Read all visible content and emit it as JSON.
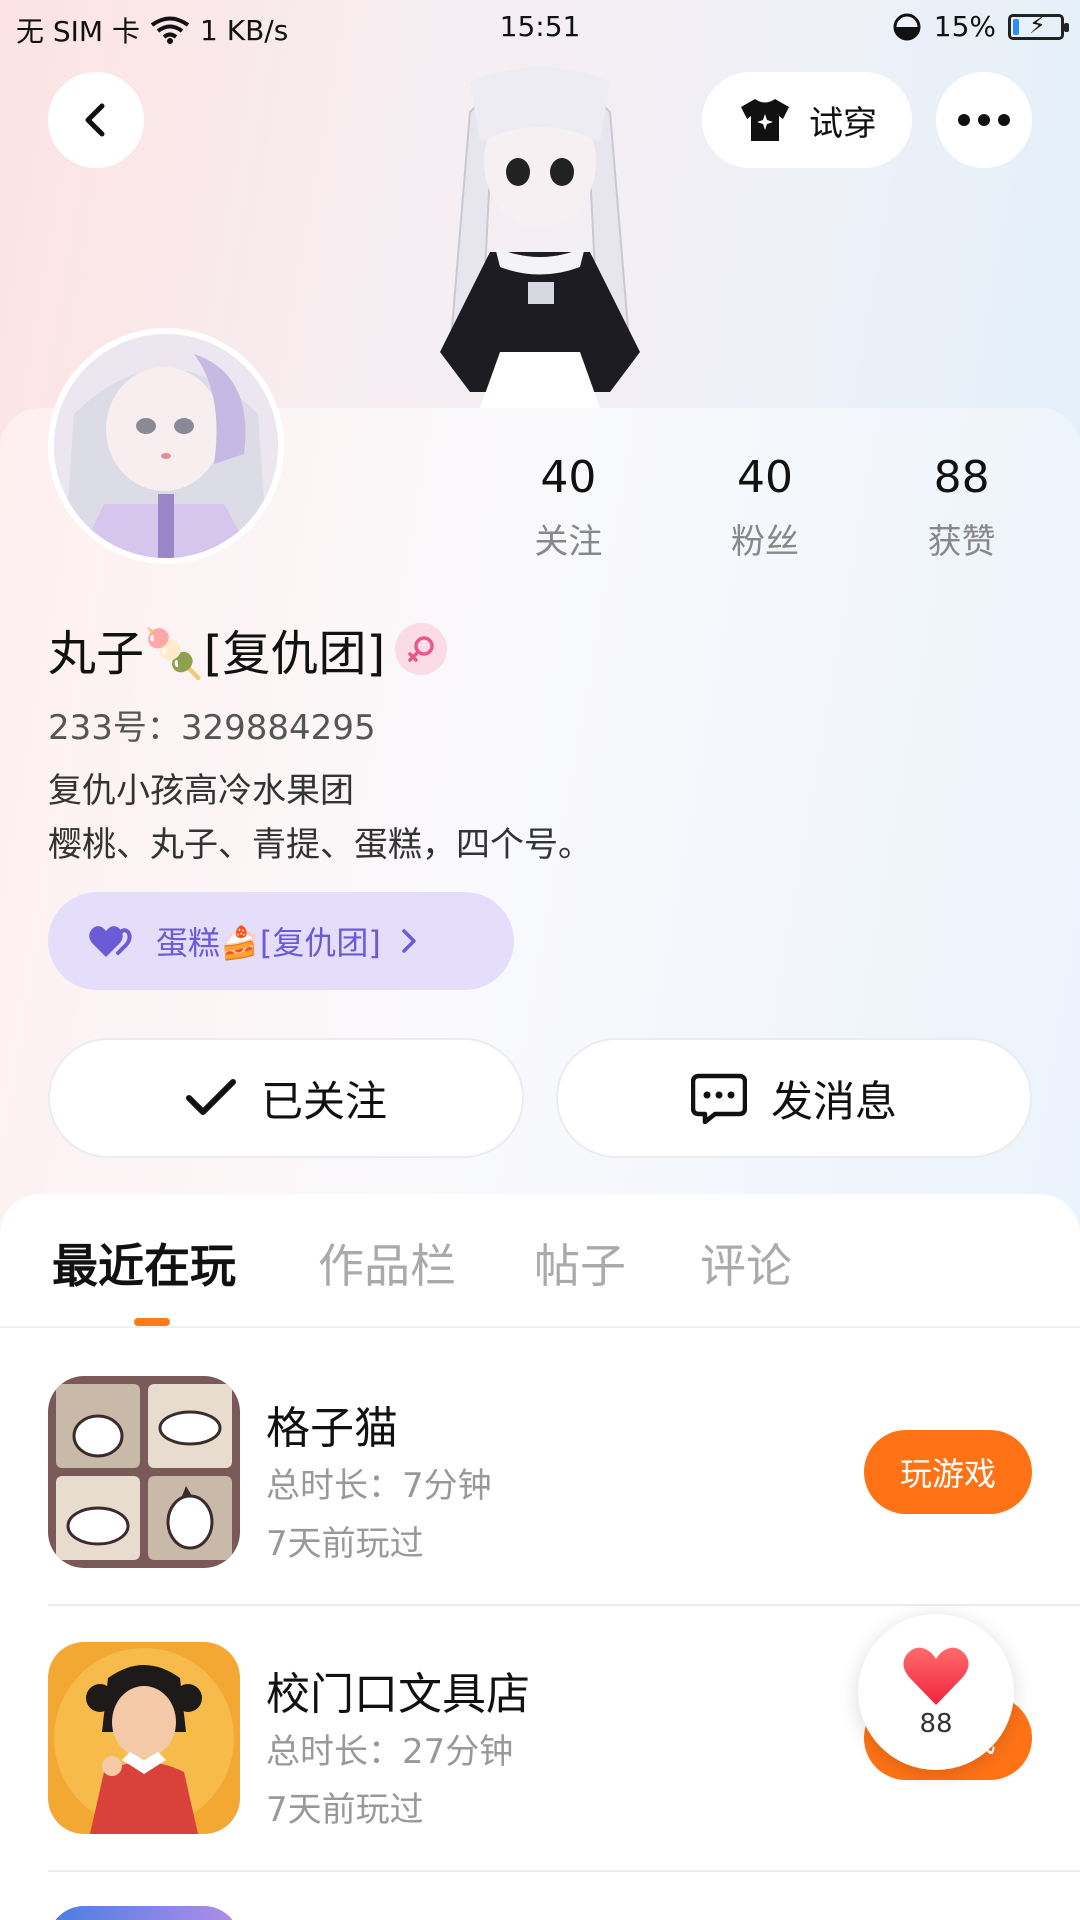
{
  "status_bar": {
    "carrier": "无 SIM 卡",
    "network_speed": "1 KB/s",
    "time": "15:51",
    "battery": "15%"
  },
  "header": {
    "try_on_label": "试穿",
    "icons": [
      "back-arrow-icon",
      "tshirt-icon",
      "more-dots-icon"
    ]
  },
  "profile": {
    "stats": [
      {
        "value": "40",
        "label": "关注"
      },
      {
        "value": "40",
        "label": "粉丝"
      },
      {
        "value": "88",
        "label": "获赞"
      }
    ],
    "nickname": "丸子🍡[复仇团]",
    "gender": "female",
    "user_id": "233号：329884295",
    "bio_line1": "复仇小孩高冷水果团",
    "bio_line2": "樱桃、丸子、青提、蛋糕，四个号。",
    "relation_label": "蛋糕🍰[复仇团]",
    "relation_color": "#6c5bd6"
  },
  "actions": {
    "followed_label": "已关注",
    "message_label": "发消息"
  },
  "tabs": [
    {
      "label": "最近在玩",
      "active": true
    },
    {
      "label": "作品栏",
      "active": false
    },
    {
      "label": "帖子",
      "active": false
    },
    {
      "label": "评论",
      "active": false
    }
  ],
  "games": [
    {
      "name": "格子猫",
      "duration": "总时长：7分钟",
      "last_played": "7天前玩过",
      "button": "玩游戏"
    },
    {
      "name": "校门口文具店",
      "duration": "总时长：27分钟",
      "last_played": "7天前玩过",
      "button": "玩游戏"
    }
  ],
  "like_bubble": {
    "count": "88"
  },
  "colors": {
    "accent_orange": "#ff7316",
    "relation_pill_bg": "#e5defa",
    "heart_red": "#f5344a"
  }
}
